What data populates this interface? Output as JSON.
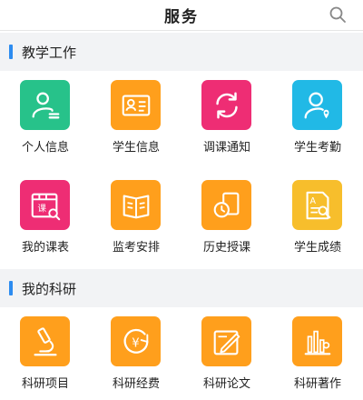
{
  "header": {
    "title": "服务"
  },
  "sections": [
    {
      "title": "教学工作",
      "items": [
        {
          "label": "个人信息",
          "icon": "person-card-icon",
          "color": "#27c28a"
        },
        {
          "label": "学生信息",
          "icon": "id-card-icon",
          "color": "#ff9f1c"
        },
        {
          "label": "调课通知",
          "icon": "refresh-icon",
          "color": "#ee2d74"
        },
        {
          "label": "学生考勤",
          "icon": "person-location-icon",
          "color": "#21b9e6"
        },
        {
          "label": "我的课表",
          "icon": "schedule-icon",
          "color": "#ee2d74",
          "glyph": "课"
        },
        {
          "label": "监考安排",
          "icon": "open-book-icon",
          "color": "#ff9f1c"
        },
        {
          "label": "历史授课",
          "icon": "history-icon",
          "color": "#ff9f1c"
        },
        {
          "label": "学生成绩",
          "icon": "grade-report-icon",
          "color": "#f7be2c",
          "glyph": "A"
        }
      ]
    },
    {
      "title": "我的科研",
      "items": [
        {
          "label": "科研项目",
          "icon": "microscope-icon",
          "color": "#ff9f1c"
        },
        {
          "label": "科研经费",
          "icon": "yuan-coin-icon",
          "color": "#ff9f1c",
          "glyph": "¥"
        },
        {
          "label": "科研论文",
          "icon": "pen-paper-icon",
          "color": "#ff9f1c"
        },
        {
          "label": "科研著作",
          "icon": "bar-stats-icon",
          "color": "#ff9f1c"
        }
      ]
    }
  ]
}
